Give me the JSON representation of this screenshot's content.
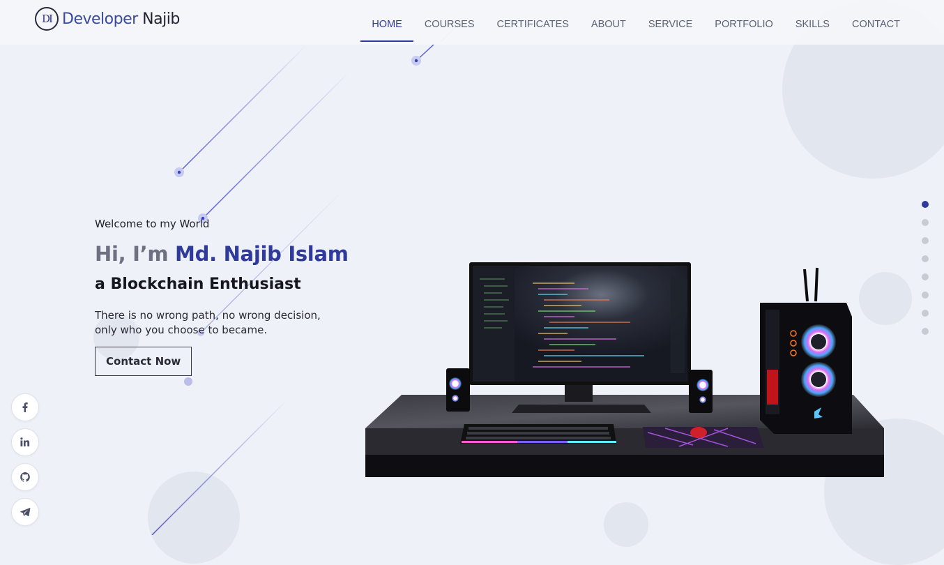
{
  "brand": {
    "part1": "Developer",
    "part2": "Najib",
    "mark": "DI"
  },
  "nav": {
    "items": [
      "HOME",
      "COURSES",
      "CERTIFICATES",
      "ABOUT",
      "SERVICE",
      "PORTFOLIO",
      "SKILLS",
      "CONTACT"
    ],
    "active": "HOME"
  },
  "hero": {
    "welcome": "Welcome to my World",
    "greeting": "Hi, I’m",
    "name": "Md. Najib Islam",
    "role": "a Blockchain Enthusiast",
    "tagline": "There is no wrong path, no wrong decision, only who you choose to became.",
    "cta": "Contact Now"
  },
  "social": [
    "facebook-icon",
    "linkedin-icon",
    "github-icon",
    "telegram-icon"
  ],
  "slider": {
    "count": 8,
    "active_index": 0
  },
  "colors": {
    "accent": "#2f3a9a",
    "background": "#eef1f7",
    "text": "#1a1a2e"
  }
}
